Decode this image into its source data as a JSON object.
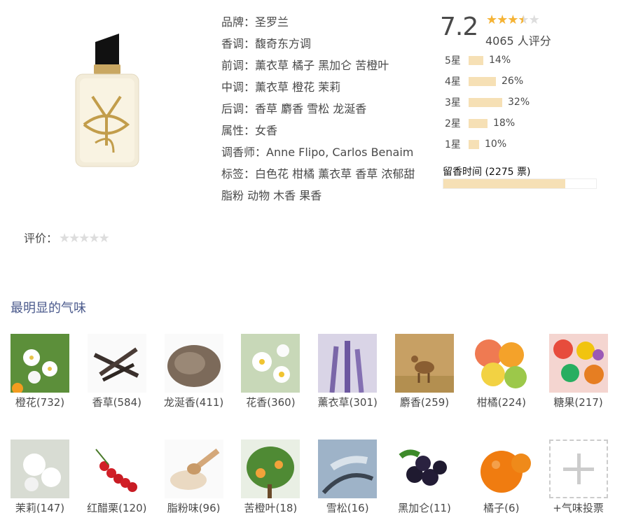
{
  "info": {
    "brand": "品牌：圣罗兰",
    "family": "香调：馥奇东方调",
    "top": "前调：薰衣草 橘子 黑加仑 苦橙叶",
    "heart": "中调：薰衣草 橙花 茉莉",
    "base": "后调：香草 麝香 雪松 龙涎香",
    "attr": "属性：女香",
    "perfumer": "调香师：Anne Flipo, Carlos Benaim",
    "tags": "标签：白色花 柑橘 薰衣草 香草 浓郁甜 脂粉 动物 木香 果香"
  },
  "rating": {
    "score": "7.2",
    "stars": 3.5,
    "count": "4065 人评分",
    "distribution": [
      {
        "label": "5星",
        "pct": "14%",
        "value": 14
      },
      {
        "label": "4星",
        "pct": "26%",
        "value": 26
      },
      {
        "label": "3星",
        "pct": "32%",
        "value": 32
      },
      {
        "label": "2星",
        "pct": "18%",
        "value": 18
      },
      {
        "label": "1星",
        "pct": "10%",
        "value": 10
      }
    ]
  },
  "longevity": {
    "label": "留香时间 (2275 票)",
    "fill_fraction": 0.8
  },
  "user_rating": {
    "label": "评价："
  },
  "notes_section": {
    "title": "最明显的气味",
    "row1": [
      {
        "label": "橙花(732)",
        "icon": "orange-blossom"
      },
      {
        "label": "香草(584)",
        "icon": "vanilla"
      },
      {
        "label": "龙涎香(411)",
        "icon": "ambergris"
      },
      {
        "label": "花香(360)",
        "icon": "floral"
      },
      {
        "label": "薰衣草(301)",
        "icon": "lavender"
      },
      {
        "label": "麝香(259)",
        "icon": "musk-deer"
      },
      {
        "label": "柑橘(224)",
        "icon": "citrus"
      },
      {
        "label": "糖果(217)",
        "icon": "candy"
      }
    ],
    "row2": [
      {
        "label": "茉莉(147)",
        "icon": "jasmine"
      },
      {
        "label": "红醋栗(120)",
        "icon": "redcurrant"
      },
      {
        "label": "脂粉味(96)",
        "icon": "powder"
      },
      {
        "label": "苦橙叶(18)",
        "icon": "petitgrain"
      },
      {
        "label": "雪松(16)",
        "icon": "cedar"
      },
      {
        "label": "黑加仑(11)",
        "icon": "blackcurrant"
      },
      {
        "label": "橘子(6)",
        "icon": "mandarin"
      },
      {
        "label": "+气味投票",
        "icon": "add-vote"
      }
    ]
  }
}
